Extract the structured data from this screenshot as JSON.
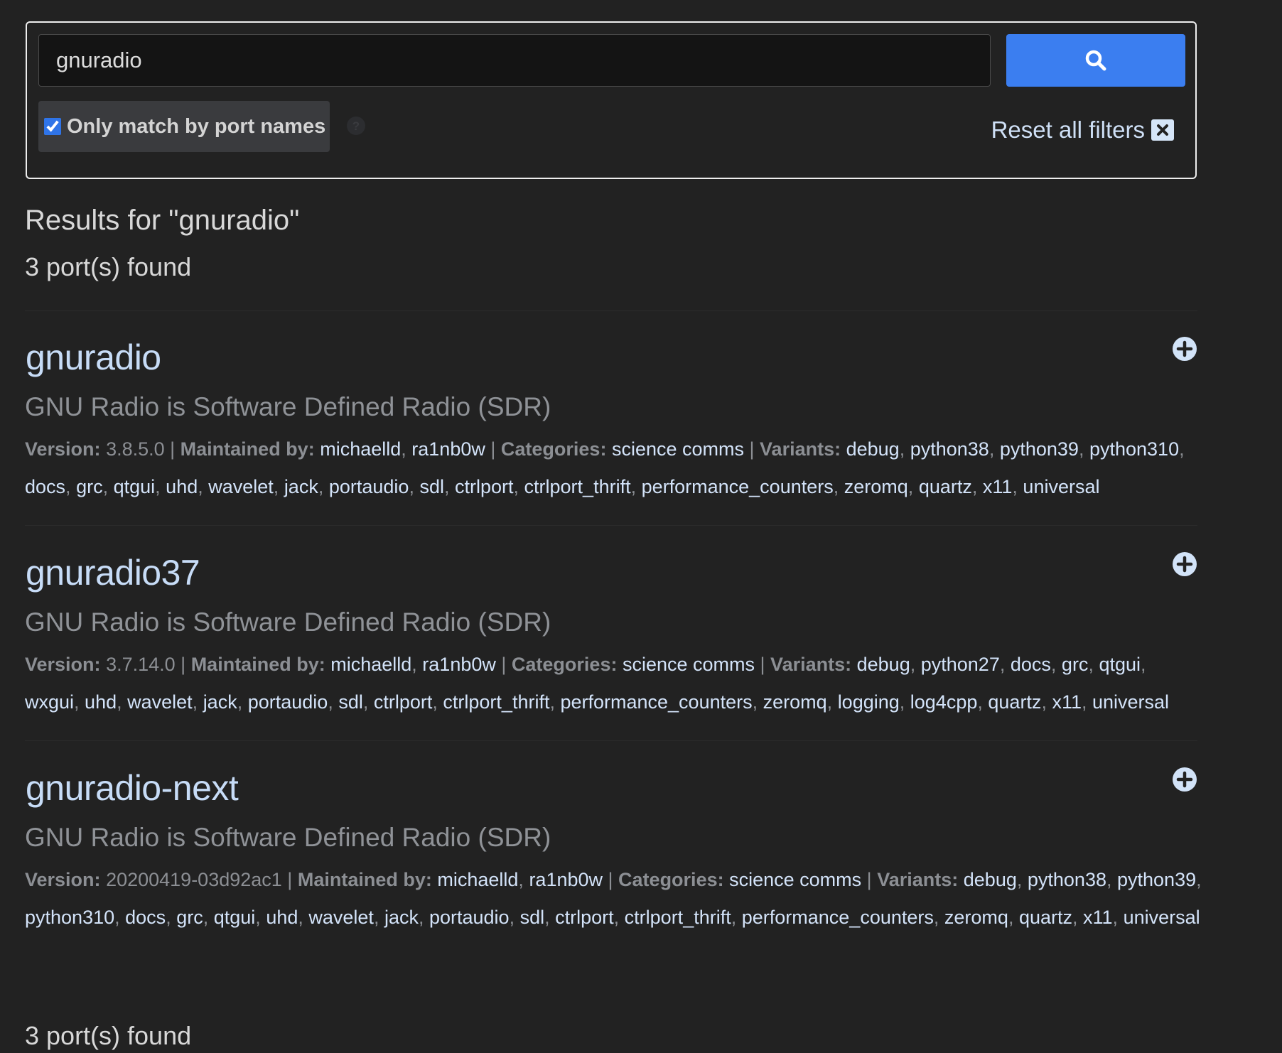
{
  "search": {
    "query": "gnuradio",
    "only_match_label": "Only match by port names",
    "only_match_checked": true,
    "reset_label": "Reset all filters"
  },
  "results": {
    "title": "Results for \"gnuradio\"",
    "count_text": "3 port(s) found",
    "footer_count_text": "3 port(s) found"
  },
  "labels": {
    "version": "Version:",
    "maintained_by": "Maintained by:",
    "categories": "Categories:",
    "variants": "Variants:"
  },
  "ports": [
    {
      "name": "gnuradio",
      "description": "GNU Radio is Software Defined Radio (SDR)",
      "version": "3.8.5.0",
      "maintainers": [
        "michaelld",
        "ra1nb0w"
      ],
      "categories": "science comms",
      "variants": [
        "debug",
        "python38",
        "python39",
        "python310",
        "docs",
        "grc",
        "qtgui",
        "uhd",
        "wavelet",
        "jack",
        "portaudio",
        "sdl",
        "ctrlport",
        "ctrlport_thrift",
        "performance_counters",
        "zeromq",
        "quartz",
        "x11",
        "universal"
      ]
    },
    {
      "name": "gnuradio37",
      "description": "GNU Radio is Software Defined Radio (SDR)",
      "version": "3.7.14.0",
      "maintainers": [
        "michaelld",
        "ra1nb0w"
      ],
      "categories": "science comms",
      "variants": [
        "debug",
        "python27",
        "docs",
        "grc",
        "qtgui",
        "wxgui",
        "uhd",
        "wavelet",
        "jack",
        "portaudio",
        "sdl",
        "ctrlport",
        "ctrlport_thrift",
        "performance_counters",
        "zeromq",
        "logging",
        "log4cpp",
        "quartz",
        "x11",
        "universal"
      ]
    },
    {
      "name": "gnuradio-next",
      "description": "GNU Radio is Software Defined Radio (SDR)",
      "version": "20200419-03d92ac1",
      "maintainers": [
        "michaelld",
        "ra1nb0w"
      ],
      "categories": "science comms",
      "variants": [
        "debug",
        "python38",
        "python39",
        "python310",
        "docs",
        "grc",
        "qtgui",
        "uhd",
        "wavelet",
        "jack",
        "portaudio",
        "sdl",
        "ctrlport",
        "ctrlport_thrift",
        "performance_counters",
        "zeromq",
        "quartz",
        "x11",
        "universal"
      ]
    }
  ],
  "icons": {
    "search_button": "search-icon",
    "help": "question-circle-icon",
    "reset": "close-box-icon",
    "add": "plus-circle-icon"
  },
  "colors": {
    "background": "#222222",
    "accent": "#3b7ef0",
    "link": "#d3e3f9",
    "muted": "#8c8f94"
  }
}
